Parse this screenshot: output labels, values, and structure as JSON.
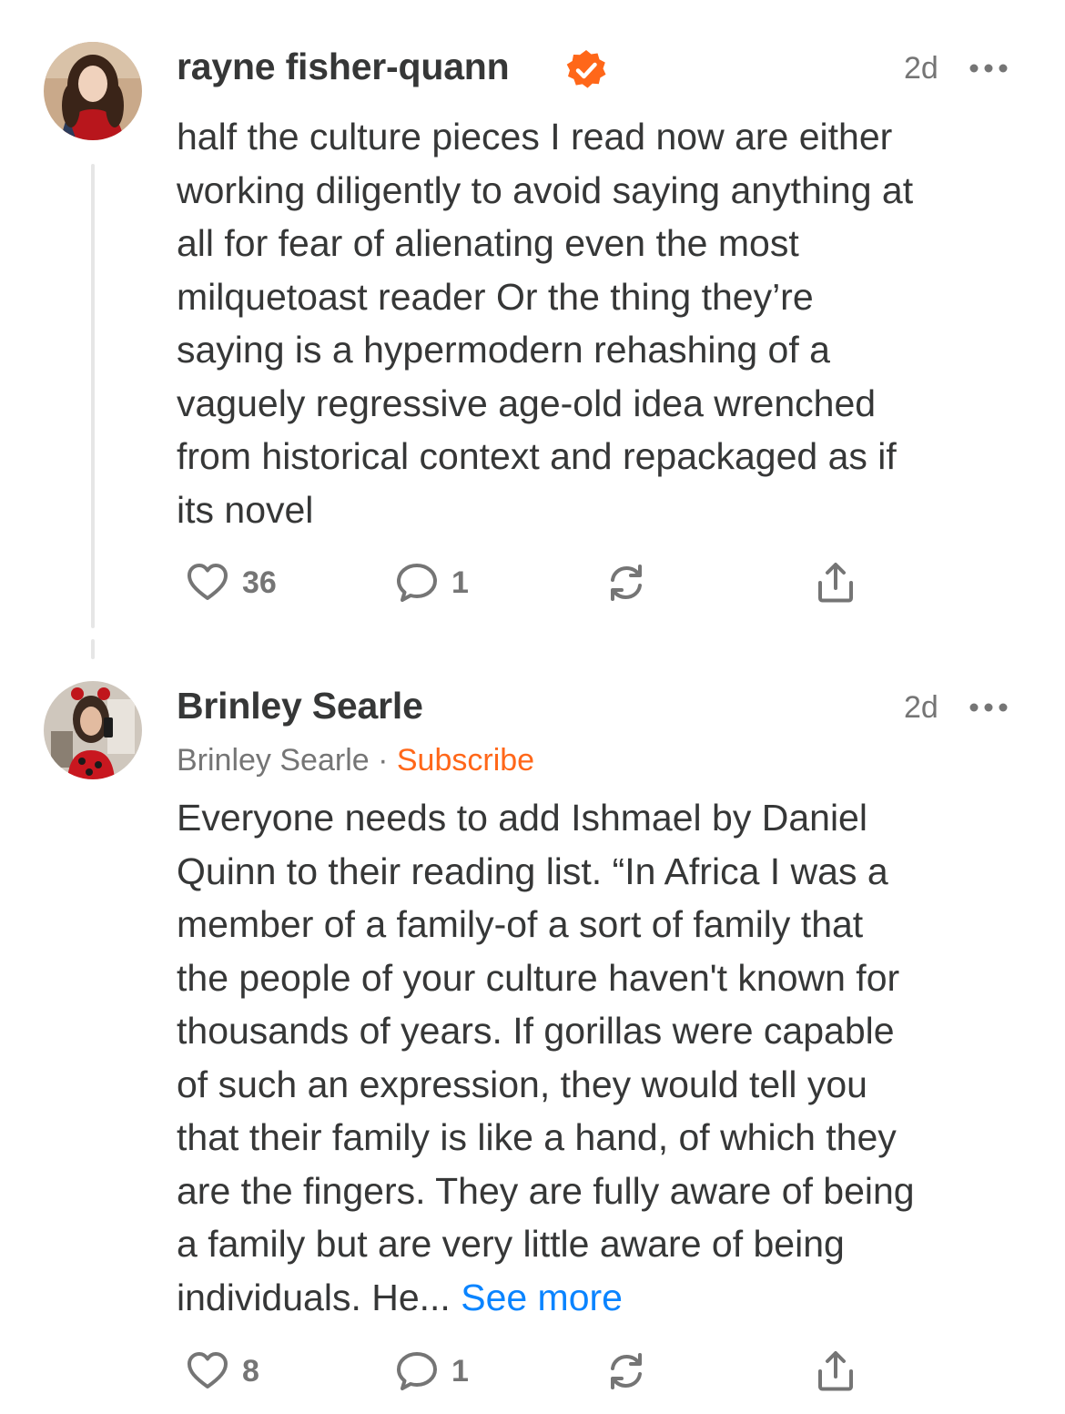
{
  "colors": {
    "accent": "#ff6719",
    "link": "#0a84ff",
    "text": "#363737",
    "muted": "#757575"
  },
  "comments": [
    {
      "author": "rayne fisher-quann",
      "verified_icon": "verified-badge-icon",
      "time": "2d",
      "body": "half the culture pieces I read now are either\nworking diligently to avoid saying anything at\nall for fear of alienating even the most\nmilquetoast reader Or the thing they’re\nsaying is a hypermodern rehashing of a\nvaguely regressive age-old idea wrenched\nfrom historical context and repackaged as if\nits novel",
      "likes": "36",
      "replies": "1"
    },
    {
      "author": "Brinley Searle",
      "subtitle_name": "Brinley Searle",
      "subtitle_separator": " · ",
      "subscribe_label": "Subscribe",
      "time": "2d",
      "body": "Everyone needs to add Ishmael by Daniel\nQuinn to their reading list. “In Africa I was a\nmember of a family-of a sort of family that\nthe people of your culture haven't known for\nthousands of years. If gorillas were capable\nof such an expression, they would tell you\nthat their family is like a hand, of which they\nare the fingers. They are fully aware of being\na family but are very little aware of being\nindividuals. He... ",
      "see_more": "See more",
      "likes": "8",
      "replies": "1"
    }
  ]
}
